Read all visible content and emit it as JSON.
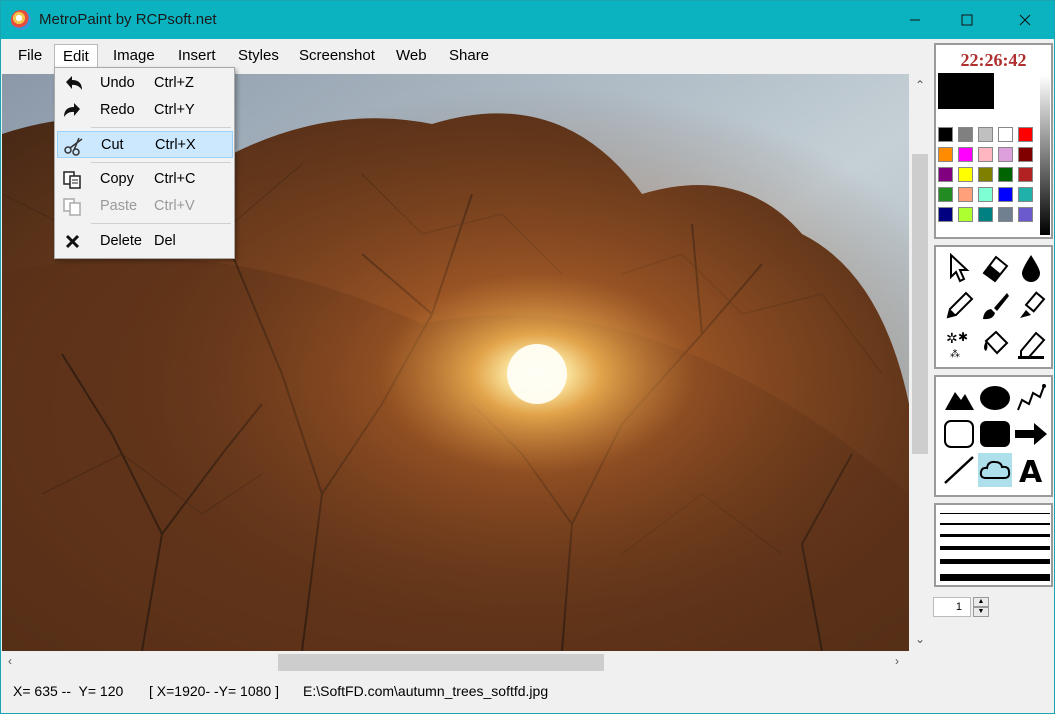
{
  "window": {
    "title": "MetroPaint by RCPsoft.net"
  },
  "menu": {
    "items": [
      "File",
      "Edit",
      "Image",
      "Insert",
      "Styles",
      "Screenshot",
      "Web",
      "Share"
    ],
    "open": "Edit"
  },
  "edit_menu": [
    {
      "label": "Undo",
      "shortcut": "Ctrl+Z",
      "icon": "undo-icon",
      "enabled": true
    },
    {
      "label": "Redo",
      "shortcut": "Ctrl+Y",
      "icon": "redo-icon",
      "enabled": true
    },
    {
      "label": "Cut",
      "shortcut": "Ctrl+X",
      "icon": "scissors-icon",
      "enabled": true,
      "highlighted": true
    },
    {
      "label": "Copy",
      "shortcut": "Ctrl+C",
      "icon": "copy-icon",
      "enabled": true
    },
    {
      "label": "Paste",
      "shortcut": "Ctrl+V",
      "icon": "paste-icon",
      "enabled": false
    },
    {
      "label": "Delete",
      "shortcut": "Del",
      "icon": "delete-x-icon",
      "enabled": true
    }
  ],
  "clock": "22:26:42",
  "status": {
    "coords": "X= 635 --  Y= 120",
    "image_size": "[ X=1920- -Y= 1080 ]",
    "file_path": "E:\\SoftFD.com\\autumn_trees_softfd.jpg"
  },
  "line_width": "1",
  "colors": {
    "titlebar": "#0bb3c1",
    "palette": [
      "#000000",
      "#808080",
      "#c0c0c0",
      "#ffffff",
      "#ff0000",
      "#ff8c00",
      "#ff00ff",
      "#ffb6c1",
      "#dda0dd",
      "#800000",
      "#800080",
      "#ffff00",
      "#808000",
      "#006400",
      "#b22222",
      "#228b22",
      "#ffa07a",
      "#7fffd4",
      "#0000ff",
      "#20b2aa",
      "#000080",
      "#adff2f",
      "#008080",
      "#708090",
      "#6a5acd"
    ]
  },
  "tools": {
    "group1": [
      "pointer-icon",
      "eraser-icon",
      "drop-icon",
      "pencil-icon",
      "brush-icon",
      "fill-brush-icon",
      "sparkle-icon",
      "paint-bucket-icon",
      "highlighter-icon"
    ],
    "group2": [
      "triangle-icon",
      "ellipse-icon",
      "polyline-icon",
      "rectangle-outline-icon",
      "rounded-rect-icon",
      "arrow-icon",
      "line-icon",
      "cloud-icon",
      "text-icon"
    ]
  }
}
